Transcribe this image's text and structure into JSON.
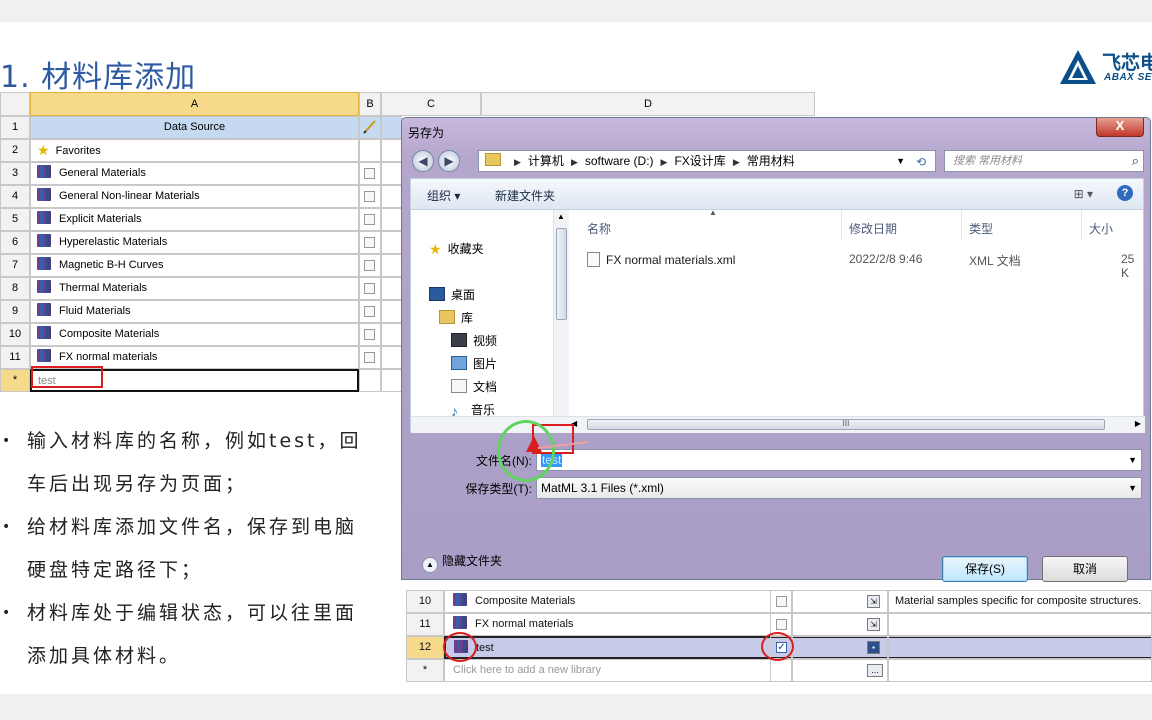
{
  "slide": {
    "title": "1. 材料库添加",
    "logo_text": "飞芯电",
    "logo_sub": "ABAX SEN"
  },
  "sheet": {
    "columns": [
      "A",
      "B",
      "C",
      "D"
    ],
    "header_row": "Data Source",
    "rows": [
      {
        "num": "2",
        "label": "Favorites",
        "icon": "star-icon",
        "check": false
      },
      {
        "num": "3",
        "label": "General Materials",
        "icon": "library-icon",
        "check": true
      },
      {
        "num": "4",
        "label": "General Non-linear Materials",
        "icon": "library-icon",
        "check": true
      },
      {
        "num": "5",
        "label": "Explicit Materials",
        "icon": "library-icon",
        "check": true
      },
      {
        "num": "6",
        "label": "Hyperelastic Materials",
        "icon": "library-icon",
        "check": true
      },
      {
        "num": "7",
        "label": "Magnetic B-H Curves",
        "icon": "library-icon",
        "check": true
      },
      {
        "num": "8",
        "label": "Thermal Materials",
        "icon": "library-icon",
        "check": true
      },
      {
        "num": "9",
        "label": "Fluid Materials",
        "icon": "library-icon",
        "check": true
      },
      {
        "num": "10",
        "label": "Composite Materials",
        "icon": "library-icon",
        "check": true
      },
      {
        "num": "11",
        "label": "FX normal materials",
        "icon": "library-icon",
        "check": true
      }
    ],
    "header_num": "1",
    "new_row_num": "*",
    "new_row_value": "test"
  },
  "bullets": [
    {
      "line1": "输入材料库的名称，例如test，回",
      "line2": "车后出现另存为页面；"
    },
    {
      "line1": "给材料库添加文件名，保存到电脑",
      "line2": "硬盘特定路径下；"
    },
    {
      "line1": "材料库处于编辑状态，可以往里面",
      "line2": "添加具体材料。"
    }
  ],
  "dialog": {
    "title": "另存为",
    "close_label": "X",
    "back_label": "◀",
    "forward_label": "▶",
    "path": [
      "计算机",
      "software (D:)",
      "FX设计库",
      "常用材料"
    ],
    "search_placeholder": "搜索 常用材料",
    "toolbar": {
      "organize": "组织 ▾",
      "new_folder": "新建文件夹",
      "view": "⊞ ▾",
      "help": "?"
    },
    "nav_items": [
      {
        "label": "收藏夹",
        "icon": "star-icon"
      },
      {
        "label": "桌面",
        "icon": "desktop-icon"
      },
      {
        "label": "库",
        "icon": "library-folder-icon"
      },
      {
        "label": "视频",
        "icon": "video-icon"
      },
      {
        "label": "图片",
        "icon": "picture-icon"
      },
      {
        "label": "文档",
        "icon": "document-icon"
      },
      {
        "label": "音乐",
        "icon": "music-icon"
      }
    ],
    "file_columns": {
      "name": "名称",
      "modified": "修改日期",
      "type": "类型",
      "size": "大小"
    },
    "files": [
      {
        "name": "FX normal materials.xml",
        "modified": "2022/2/8 9:46",
        "type": "XML 文档",
        "size": "25 K"
      }
    ],
    "filename_label": "文件名(N):",
    "filename_value": "test",
    "filetype_label": "保存类型(T):",
    "filetype_value": "MatML 3.1 Files (*.xml)",
    "hide_folders": "隐藏文件夹",
    "save_button": "保存(S)",
    "cancel_button": "取消",
    "hscroll_grip": "III"
  },
  "lower_table": {
    "rows": [
      {
        "num": "10",
        "label": "Composite Materials",
        "desc": "Material samples specific for composite structures."
      },
      {
        "num": "11",
        "label": "FX normal materials",
        "desc": ""
      },
      {
        "num": "12",
        "label": "test",
        "desc": ""
      }
    ],
    "new_row_num": "*",
    "new_row_placeholder": "Click here to add a new library",
    "more_label": "..."
  }
}
